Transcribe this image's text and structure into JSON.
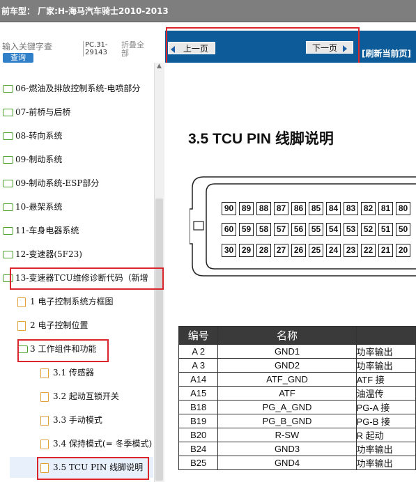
{
  "titlebar": {
    "text": "前车型：  厂家:H-海马汽车骑士2010-2013"
  },
  "sidebar": {
    "search_placeholder": "输入关键字查",
    "search_button": "查询",
    "pc_code": "PC.31-29143",
    "collapse_all": "折叠全部",
    "items": [
      {
        "label": "06-燃油及排放控制系统-电喷部分",
        "icon": "folder-icon"
      },
      {
        "label": "07-前桥与后桥",
        "icon": "folder-icon"
      },
      {
        "label": "08-转向系统",
        "icon": "folder-icon"
      },
      {
        "label": "09-制动系统",
        "icon": "folder-icon"
      },
      {
        "label": "09-制动系统-ESP部分",
        "icon": "folder-icon"
      },
      {
        "label": "10-悬架系统",
        "icon": "folder-icon"
      },
      {
        "label": "11-车身电器系统",
        "icon": "folder-icon"
      },
      {
        "label": "12-变速器(5F23)",
        "icon": "folder-icon"
      },
      {
        "label": "13-变速器TCU维修诊断代码（新增",
        "icon": "folder-icon"
      },
      {
        "label": "1 电子控制系统方框图",
        "icon": "document-icon"
      },
      {
        "label": "2 电子控制位置",
        "icon": "document-icon"
      },
      {
        "label": "3 工作组件和功能",
        "icon": "folder-icon"
      },
      {
        "label": "3.1 传感器",
        "icon": "document-icon"
      },
      {
        "label": "3.2 起动互锁开关",
        "icon": "document-icon"
      },
      {
        "label": "3.3 手动模式",
        "icon": "document-icon"
      },
      {
        "label": "3.4 保持模式(= 冬季模式)",
        "icon": "document-icon"
      },
      {
        "label": "3.5 TCU PIN 线脚说明",
        "icon": "document-icon"
      }
    ]
  },
  "toolbar": {
    "prev_label": "上一页",
    "next_label": "下一页",
    "refresh_label": "[刷新当前页]"
  },
  "doc": {
    "title": "3.5    TCU PIN 线脚说明",
    "connector_rows": [
      [
        "90",
        "89",
        "88",
        "87",
        "86",
        "85",
        "84",
        "83",
        "82",
        "81",
        "80"
      ],
      [
        "60",
        "59",
        "58",
        "57",
        "56",
        "55",
        "54",
        "53",
        "52",
        "51",
        "50"
      ],
      [
        "30",
        "29",
        "28",
        "27",
        "26",
        "25",
        "24",
        "23",
        "22",
        "21",
        "20"
      ]
    ],
    "table": {
      "headers": [
        "编号",
        "名称",
        ""
      ],
      "rows": [
        [
          "A 2",
          "GND1",
          "功率输出"
        ],
        [
          "A 3",
          "GND2",
          "功率输出"
        ],
        [
          "A14",
          "ATF_GND",
          "ATF 接"
        ],
        [
          "A15",
          "ATF",
          "油温传"
        ],
        [
          "B18",
          "PG_A_GND",
          "PG-A 接"
        ],
        [
          "B19",
          "PG_B_GND",
          "PG-B 接"
        ],
        [
          "B20",
          "R-SW",
          "R 起动"
        ],
        [
          "B24",
          "GND3",
          "功率输出"
        ],
        [
          "B25",
          "GND4",
          "功率输出"
        ]
      ]
    }
  },
  "colors": {
    "accent_red": "#d9252b",
    "topbar_blue": "#0d5b98",
    "folder_green": "#4aa12a",
    "doc_orange": "#e0a23a"
  }
}
